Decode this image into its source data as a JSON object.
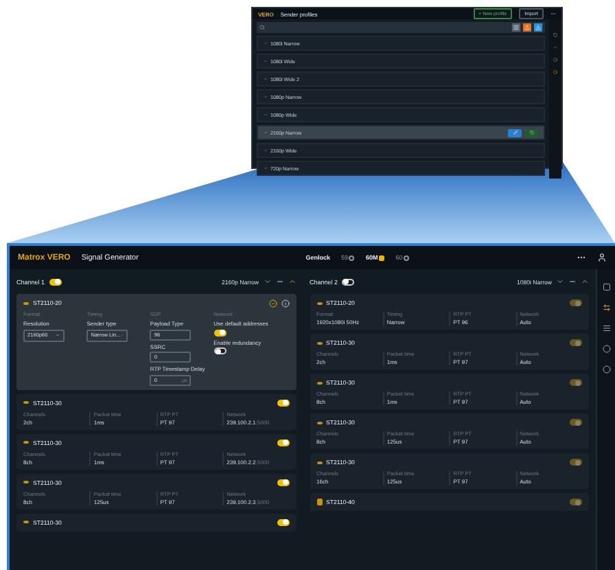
{
  "inset": {
    "brand": "VERO",
    "title": "Sender profiles",
    "actions": [
      {
        "label": "+ New profile",
        "kind": "primary"
      },
      {
        "label": "Import",
        "kind": "plain"
      }
    ],
    "profiles": [
      {
        "name": "1080i Narrow",
        "selected": false
      },
      {
        "name": "1080i Wide",
        "selected": false
      },
      {
        "name": "1080i Wide 2",
        "selected": false
      },
      {
        "name": "1080p Narrow",
        "selected": false
      },
      {
        "name": "1080p Wide",
        "selected": false
      },
      {
        "name": "2160p Narrow",
        "selected": true
      },
      {
        "name": "2160p Wide",
        "selected": false
      },
      {
        "name": "720p Narrow",
        "selected": false
      }
    ]
  },
  "app": {
    "brand_prefix": "Matrox",
    "brand": "VERO",
    "title": "Signal Generator",
    "genlock": {
      "label": "Genlock",
      "options": [
        {
          "label": "59",
          "selected": false
        },
        {
          "label": "60M",
          "selected": true
        },
        {
          "label": "60",
          "selected": false
        }
      ]
    }
  },
  "channels": [
    {
      "label": "Channel 1",
      "on": true,
      "profile": "2160p Narrow",
      "streams": [
        {
          "kind": "editor",
          "type": "ST2110-20",
          "sections": [
            {
              "heading": "Format",
              "controls": [
                {
                  "kind": "select",
                  "label": "Resolution",
                  "value": "2160p60"
                }
              ]
            },
            {
              "heading": "Timing",
              "controls": [
                {
                  "kind": "select",
                  "label": "Sender type",
                  "value": "Narrow Lin..."
                }
              ]
            },
            {
              "heading": "SDP",
              "controls": [
                {
                  "kind": "input",
                  "label": "Payload Type",
                  "value": "96"
                },
                {
                  "kind": "input",
                  "label": "SSRC",
                  "value": "0"
                },
                {
                  "kind": "input",
                  "label": "RTP Timestamp Delay",
                  "value": "0",
                  "unit": "µs"
                }
              ]
            },
            {
              "heading": "Network",
              "controls": [
                {
                  "kind": "switch",
                  "label": "Use default addresses",
                  "on": true
                },
                {
                  "kind": "switch",
                  "label": "Enable redundancy",
                  "on": false
                }
              ]
            }
          ]
        },
        {
          "kind": "summary",
          "type": "ST2110-30",
          "on": true,
          "fields": [
            {
              "label": "Channels",
              "value": "2ch"
            },
            {
              "label": "Packet time",
              "value": "1ms"
            },
            {
              "label": "RTP PT",
              "value": "PT 97"
            },
            {
              "label": "Network",
              "value": "239.100.2.1",
              "port": ":5000"
            }
          ]
        },
        {
          "kind": "summary",
          "type": "ST2110-30",
          "on": true,
          "fields": [
            {
              "label": "Channels",
              "value": "8ch"
            },
            {
              "label": "Packet time",
              "value": "1ms"
            },
            {
              "label": "RTP PT",
              "value": "PT 97"
            },
            {
              "label": "Network",
              "value": "239.100.2.2",
              "port": ":5000"
            }
          ]
        },
        {
          "kind": "summary",
          "type": "ST2110-30",
          "on": true,
          "fields": [
            {
              "label": "Channels",
              "value": "8ch"
            },
            {
              "label": "Packet time",
              "value": "125us"
            },
            {
              "label": "RTP PT",
              "value": "PT 97"
            },
            {
              "label": "Network",
              "value": "239.100.2.3",
              "port": ":5000"
            }
          ]
        },
        {
          "kind": "summary",
          "type": "ST2110-30",
          "on": true
        }
      ]
    },
    {
      "label": "Channel 2",
      "on": false,
      "profile": "1080i Narrow",
      "streams": [
        {
          "kind": "summary",
          "type": "ST2110-20",
          "on": true,
          "fields": [
            {
              "label": "Format",
              "value": "1920x1080i 50Hz"
            },
            {
              "label": "Timing",
              "value": "Narrow"
            },
            {
              "label": "RTP PT",
              "value": "PT 96"
            },
            {
              "label": "Network",
              "value": "Auto"
            }
          ]
        },
        {
          "kind": "summary",
          "type": "ST2110-30",
          "on": true,
          "fields": [
            {
              "label": "Channels",
              "value": "2ch"
            },
            {
              "label": "Packet time",
              "value": "1ms"
            },
            {
              "label": "RTP PT",
              "value": "PT 97"
            },
            {
              "label": "Network",
              "value": "Auto"
            }
          ]
        },
        {
          "kind": "summary",
          "type": "ST2110-30",
          "on": true,
          "fields": [
            {
              "label": "Channels",
              "value": "8ch"
            },
            {
              "label": "Packet time",
              "value": "1ms"
            },
            {
              "label": "RTP PT",
              "value": "PT 97"
            },
            {
              "label": "Network",
              "value": "Auto"
            }
          ]
        },
        {
          "kind": "summary",
          "type": "ST2110-30",
          "on": true,
          "fields": [
            {
              "label": "Channels",
              "value": "8ch"
            },
            {
              "label": "Packet time",
              "value": "125us"
            },
            {
              "label": "RTP PT",
              "value": "PT 97"
            },
            {
              "label": "Network",
              "value": "Auto"
            }
          ]
        },
        {
          "kind": "summary",
          "type": "ST2110-30",
          "on": true,
          "fields": [
            {
              "label": "Channels",
              "value": "16ch"
            },
            {
              "label": "Packet time",
              "value": "125us"
            },
            {
              "label": "RTP PT",
              "value": "PT 97"
            },
            {
              "label": "Network",
              "value": "Auto"
            }
          ]
        },
        {
          "kind": "data",
          "type": "ST2110-40",
          "on": true
        }
      ]
    }
  ]
}
